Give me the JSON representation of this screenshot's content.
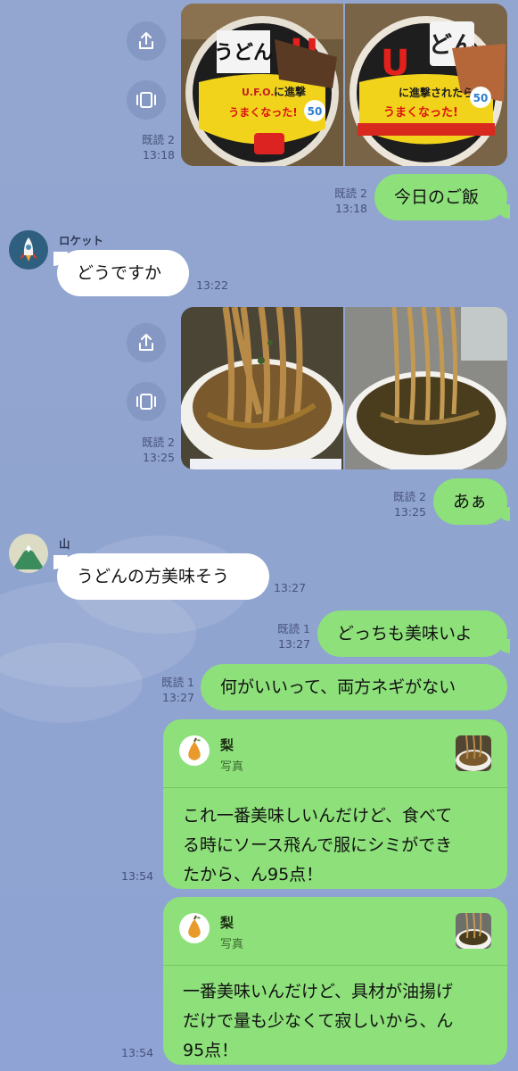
{
  "colors": {
    "background": "#92a5d1",
    "sent_bubble": "#8de07a",
    "received_bubble": "#ffffff",
    "meta_text": "#46527a"
  },
  "messages": {
    "m1": {
      "read": "既読 2",
      "time": "13:18",
      "share_icon": "share-icon",
      "gallery_icon": "gallery-icon"
    },
    "m2": {
      "read": "既読 2",
      "time": "13:18",
      "text": "今日のご飯"
    },
    "m3": {
      "sender": "ロケット",
      "avatar": "rocket-avatar",
      "text": "どうですか",
      "time": "13:22"
    },
    "m4": {
      "read": "既読 2",
      "time": "13:25"
    },
    "m5": {
      "read": "既読 2",
      "time": "13:25",
      "text": "あぁ"
    },
    "m6": {
      "sender": "山",
      "avatar": "mountain-avatar",
      "text": "うどんの方美味そう",
      "time": "13:27"
    },
    "m7": {
      "read": "既読 1",
      "time": "13:27",
      "text": "どっちも美味いよ"
    },
    "m8": {
      "read": "既読 1",
      "time": "13:27",
      "text": "何がいいって、両方ネギがない"
    },
    "m9": {
      "quote_sender": "梨",
      "quote_type": "写真",
      "lines": [
        "これ一番美味しいんだけど、食べて",
        "る時にソース飛んで服にシミができ",
        "たから、ん95点！"
      ],
      "time": "13:54"
    },
    "m10": {
      "quote_sender": "梨",
      "quote_type": "写真",
      "lines": [
        "一番美味いんだけど、具材が油揚げ",
        "だけで量も少なくて寂しいから、ん",
        "95点！"
      ],
      "time": "13:54"
    }
  }
}
